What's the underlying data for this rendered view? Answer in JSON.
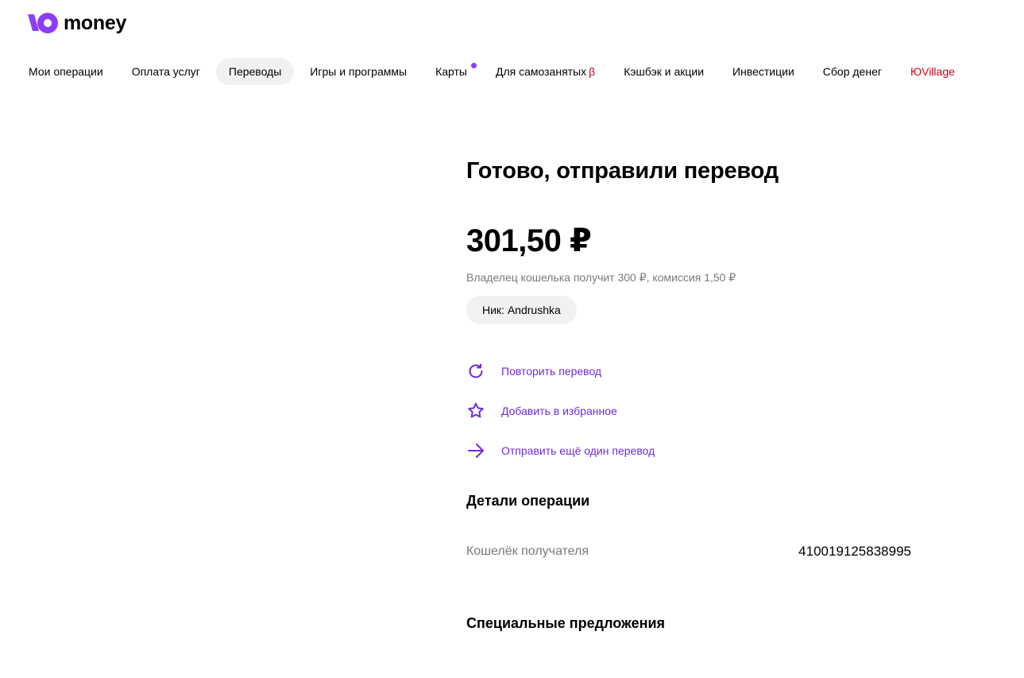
{
  "header": {
    "logo_text": "money",
    "nav": [
      {
        "label": "Мои операции"
      },
      {
        "label": "Оплата услуг"
      },
      {
        "label": "Переводы",
        "active": true
      },
      {
        "label": "Игры и программы"
      },
      {
        "label": "Карты",
        "dot": true
      },
      {
        "label": "Для самозанятых",
        "badge": "β"
      },
      {
        "label": "Кэшбэк и акции"
      },
      {
        "label": "Инвестиции"
      },
      {
        "label": "Сбор денег"
      },
      {
        "label": "ЮVillage",
        "red": true
      }
    ]
  },
  "main": {
    "title": "Готово, отправили перевод",
    "amount": "301,50 ₽",
    "subtext": "Владелец кошелька получит 300 ₽, комиссия 1,50 ₽",
    "nick_chip": "Ник: Andrushka",
    "actions": [
      {
        "label": "Повторить перевод",
        "icon": "repeat-icon"
      },
      {
        "label": "Добавить в избранное",
        "icon": "star-icon"
      },
      {
        "label": "Отправить ещё один перевод",
        "icon": "arrow-right-icon"
      }
    ],
    "details": {
      "title": "Детали операции",
      "rows": [
        {
          "label": "Кошелёк получателя",
          "value": "410019125838995"
        }
      ]
    },
    "offers": {
      "title": "Специальные предложения"
    }
  },
  "colors": {
    "accent": "#8b3ffd",
    "link": "#6f2bd9",
    "red": "#d0021b",
    "chip_bg": "#f1f1f1",
    "muted_text": "#7a7a7a"
  }
}
